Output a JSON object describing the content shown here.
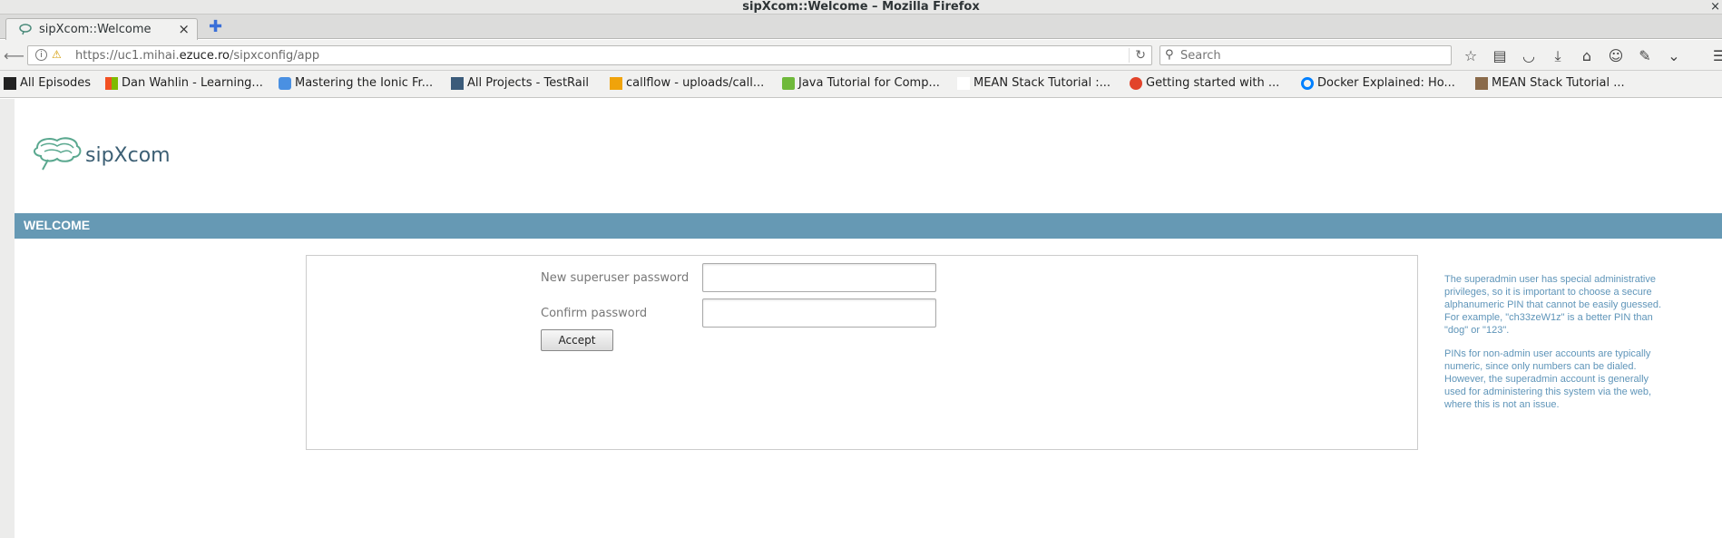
{
  "window": {
    "title": "sipXcom::Welcome – Mozilla Firefox"
  },
  "tab": {
    "title": "sipXcom::Welcome"
  },
  "address": {
    "url_prefix": "https://uc1.mihai.",
    "url_domain": "ezuce.ro",
    "url_suffix": "/sipxconfig/app"
  },
  "search": {
    "placeholder": "Search"
  },
  "bookmarks": [
    {
      "label": "All Episodes",
      "color": "#222222"
    },
    {
      "label": "Dan Wahlin - Learning...",
      "color": "#f25022"
    },
    {
      "label": "Mastering the Ionic Fr...",
      "color": "#4a90e2"
    },
    {
      "label": "All Projects - TestRail",
      "color": "#3b5b7a"
    },
    {
      "label": "callflow - uploads/call...",
      "color": "#f0a30a"
    },
    {
      "label": "Java Tutorial for Comp...",
      "color": "#6fb93b"
    },
    {
      "label": "MEAN Stack Tutorial :...",
      "color": "#ffffff"
    },
    {
      "label": "Getting started with ...",
      "color": "#e2432a"
    },
    {
      "label": "Docker Explained: Ho...",
      "color": "#0080ff"
    },
    {
      "label": "MEAN Stack Tutorial ...",
      "color": "#8a6a4a"
    }
  ],
  "page": {
    "logo_text": "sipXcom",
    "welcome_heading": "WELCOME",
    "form": {
      "new_password_label": "New superuser password",
      "confirm_password_label": "Confirm password",
      "accept_label": "Accept"
    },
    "help": {
      "p1": "The superadmin user has special administrative privileges, so it is important to choose a secure alphanumeric PIN that cannot be easily guessed. For example, \"ch33zeW1z\" is a better PIN than \"dog\" or \"123\".",
      "p2": "PINs for non-admin user accounts are typically numeric, since only numbers can be dialed. However, the superadmin account is generally used for administering this system via the web, where this is not an issue."
    }
  }
}
